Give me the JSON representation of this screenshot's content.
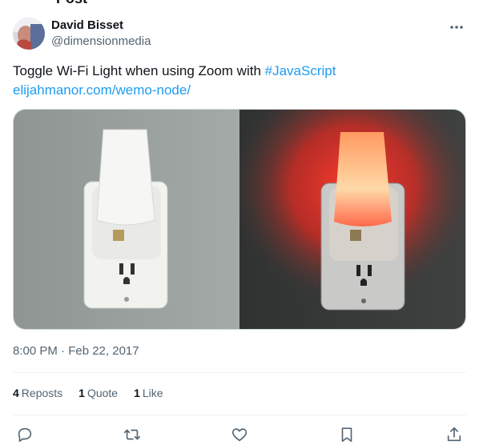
{
  "page": {
    "cut_header_text": "Post"
  },
  "author": {
    "name": "David Bisset",
    "handle": "@dimensionmedia",
    "avatar_icon": "user-avatar",
    "more_icon": "more-horizontal-icon"
  },
  "tweet": {
    "text_before": "Toggle Wi-Fi Light when using Zoom with ",
    "hashtag": "#JavaScript",
    "link": "elijahmanor.com/wemo-node/",
    "link_color": "#1d9bf0"
  },
  "media": {
    "description_icon": "photo-two-night-lights-off-and-red"
  },
  "timestamp": "8:00 PM · Feb 22, 2017",
  "stats": {
    "reposts_count": "4",
    "reposts_label": "Reposts",
    "quotes_count": "1",
    "quotes_label": "Quote",
    "likes_count": "1",
    "likes_label": "Like"
  },
  "actions": {
    "reply_icon": "reply-icon",
    "repost_icon": "repost-icon",
    "like_icon": "like-heart-icon",
    "bookmark_icon": "bookmark-icon",
    "share_icon": "share-icon"
  },
  "colors": {
    "text_primary": "#0f1419",
    "text_secondary": "#536471",
    "accent": "#1d9bf0",
    "divider": "#eff3f4"
  }
}
